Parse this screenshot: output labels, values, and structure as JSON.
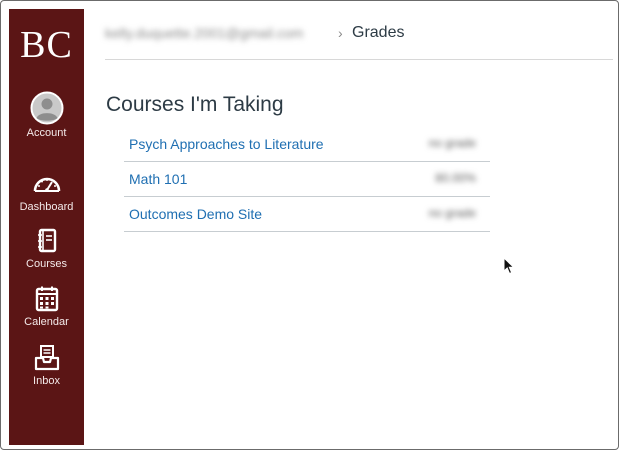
{
  "sidebar": {
    "logo": "BC",
    "items": [
      {
        "label": "Account",
        "icon": "account-avatar-icon"
      },
      {
        "label": "Dashboard",
        "icon": "dashboard-gauge-icon"
      },
      {
        "label": "Courses",
        "icon": "courses-book-icon"
      },
      {
        "label": "Calendar",
        "icon": "calendar-icon"
      },
      {
        "label": "Inbox",
        "icon": "inbox-icon"
      }
    ],
    "background_color": "#5b1515"
  },
  "breadcrumb": {
    "user": "kelly.duquette.2001@gmail.com",
    "separator": "›",
    "current": "Grades"
  },
  "page": {
    "title": "Courses I'm Taking"
  },
  "courses": [
    {
      "name": "Psych Approaches to Literature",
      "grade": "no grade"
    },
    {
      "name": "Math 101",
      "grade": "80.00%"
    },
    {
      "name": "Outcomes Demo Site",
      "grade": "no grade"
    }
  ],
  "colors": {
    "link": "#1f6fb2",
    "heading": "#2d3b45"
  }
}
